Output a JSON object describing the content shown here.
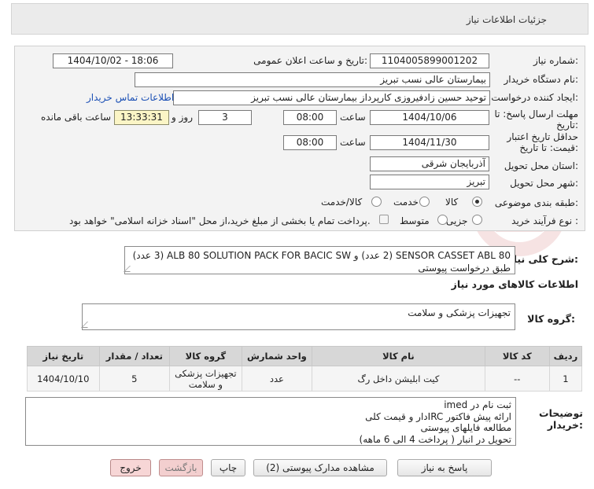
{
  "header": {
    "title": "جزئیات اطلاعات نیاز"
  },
  "form": {
    "need_number": {
      "label": "شماره نیاز:",
      "value": "1104005899001202"
    },
    "announce_datetime": {
      "label": "تاریخ و ساعت اعلان عمومی:",
      "value": "1404/10/02 - 18:06"
    },
    "buyer_org": {
      "label": "نام دستگاه خریدار:",
      "value": "بیمارستان عالی نسب تبریز"
    },
    "requester": {
      "label": "ایجاد کننده درخواست:",
      "value": "توحید حسین زادفیروزی کارپرداز بیمارستان عالی نسب تبریز",
      "contact_link": "اطلاعات تماس خریدار"
    },
    "reply_deadline": {
      "label_line1": "مهلت ارسال پاسخ: تا",
      "label_line2": "تاریخ:",
      "date": "1404/10/06",
      "time_label": "ساعت",
      "time": "08:00",
      "days": "3",
      "days_label": "روز و",
      "remaining_time": "13:33:31",
      "remaining_label": "ساعت باقی مانده"
    },
    "price_validity": {
      "label_line1": "حداقل تاریخ اعتبار",
      "label_line2": "قیمت: تا تاریخ:",
      "date": "1404/11/30",
      "time_label": "ساعت",
      "time": "08:00"
    },
    "province": {
      "label": "استان محل تحویل:",
      "value": "آذربایجان شرقی"
    },
    "city": {
      "label": "شهر محل تحویل:",
      "value": "تبریز"
    },
    "category": {
      "label": "طبقه بندی موضوعی:",
      "options": [
        "کالا",
        "خدمت",
        "کالا/خدمت"
      ],
      "selected": "کالا"
    },
    "purchase_type": {
      "label": "نوع فرآیند خرید :",
      "options": [
        "جزیی",
        "متوسط"
      ],
      "checkbox_text": "پرداخت تمام یا بخشی از مبلغ خرید،از محل \"اسناد خزانه اسلامی\" خواهد بود."
    }
  },
  "description": {
    "label": "شرح کلی نیاز:",
    "value": "SENSOR CASSET ABL 80 (2 عدد) و ALB 80 SOLUTION PACK FOR BACIC SW (3 عدد) طبق درخواست پیوستی"
  },
  "goods_info_title": "اطلاعات کالاهای مورد نیاز",
  "goods_group": {
    "label": "گروه کالا:",
    "value": "تجهیزات پزشکی و سلامت"
  },
  "table": {
    "headers": [
      "ردیف",
      "کد کالا",
      "نام کالا",
      "واحد شمارش",
      "گروه کالا",
      "تعداد / مقدار",
      "تاریخ نیاز"
    ],
    "rows": [
      [
        "1",
        "--",
        "کیت ابلیشن داخل رگ",
        "عدد",
        "تجهیزات پزشکی و سلامت",
        "5",
        "1404/10/10"
      ]
    ]
  },
  "buyer_notes": {
    "label_line1": "توضیحات",
    "label_line2": "خریدار:",
    "lines": [
      "ثبت نام در imed",
      "ارائه پیش فاکتور IRCدار و قیمت کلی",
      "مطالعه فایلهای پیوستی",
      "تحویل در انبار ( پرداخت 4 الی 6 ماهه)"
    ]
  },
  "buttons": {
    "reply": "پاسخ به نیاز",
    "attachments": "مشاهده مدارک پیوستی (2)",
    "print": "چاپ",
    "back": "بازگشت",
    "exit": "خروج"
  }
}
